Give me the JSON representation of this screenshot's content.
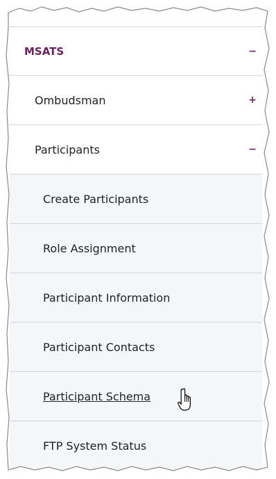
{
  "menu": {
    "section": {
      "label": "MSATS",
      "toggle": "−"
    },
    "items": [
      {
        "label": "Ombudsman",
        "toggle": "+"
      },
      {
        "label": "Participants",
        "toggle": "−"
      }
    ],
    "subitems": [
      {
        "label": "Create Participants"
      },
      {
        "label": "Role Assignment"
      },
      {
        "label": "Participant Information"
      },
      {
        "label": "Participant Contacts"
      },
      {
        "label": "Participant Schema",
        "state": "hovered"
      },
      {
        "label": "FTP System Status"
      }
    ]
  },
  "icons": {
    "cursor": "hand-pointer-icon",
    "expand": "plus-icon",
    "collapse": "minus-icon"
  },
  "colors": {
    "accent": "#6b2360",
    "row_border": "#d4d7db",
    "subitem_background": "#f5f6f7",
    "text": "#222222"
  }
}
